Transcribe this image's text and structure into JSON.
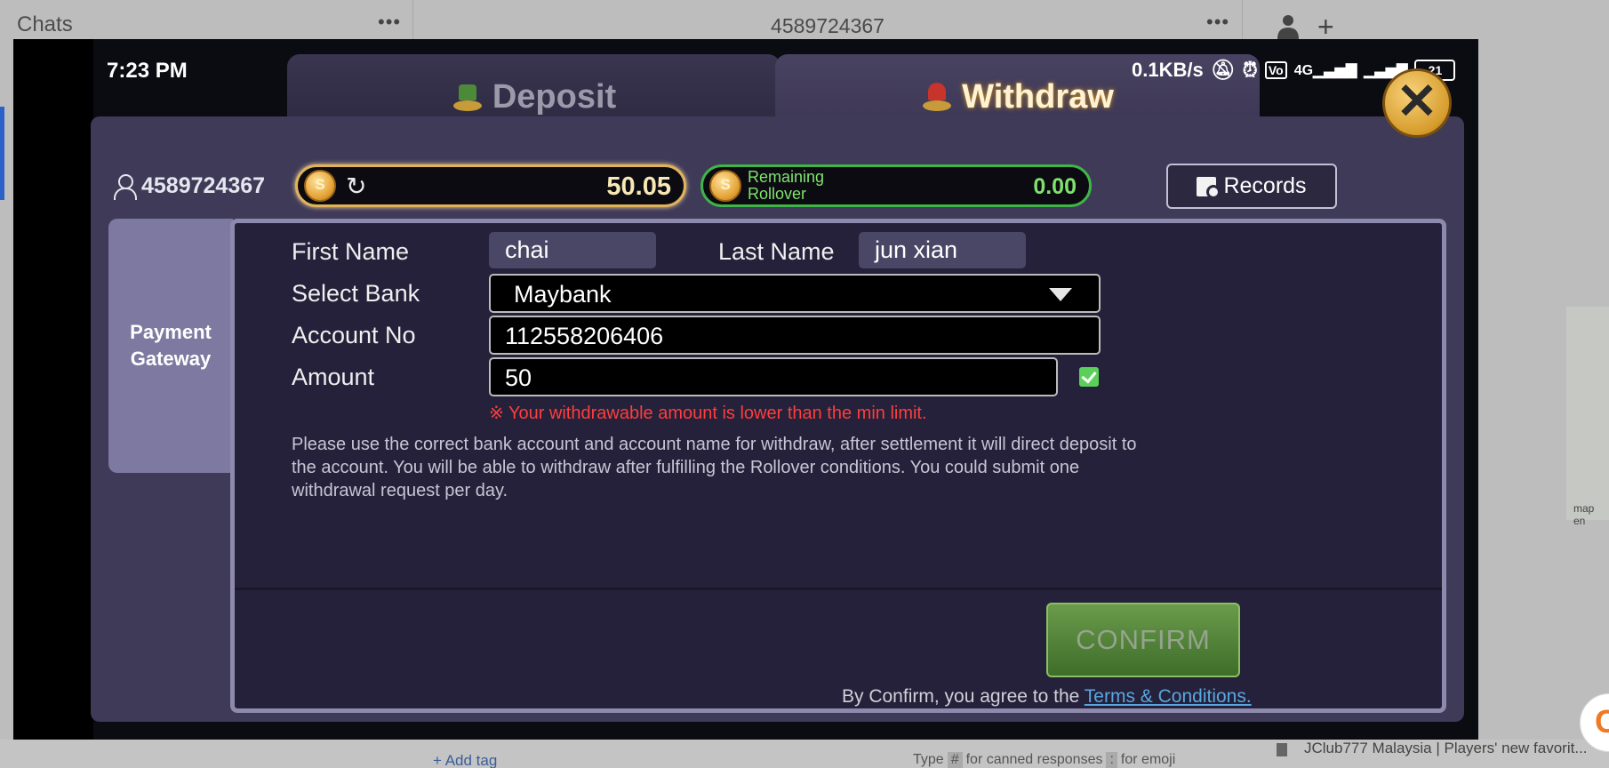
{
  "background_app": {
    "chats_title": "Chats",
    "dots": "•••",
    "conversation_title": "4589724367",
    "add_tag": "+ Add tag",
    "composer_hint_prefix": "Type",
    "composer_hint_hash": "#",
    "composer_hint_middle": "for canned responses",
    "composer_hint_colon": ":",
    "composer_hint_suffix": "for emoji",
    "snippet": "JClub777 Malaysia | Players' new favorit...",
    "map_label": "map en"
  },
  "status_bar": {
    "time": "7:23 PM",
    "speed": "0.1KB/s",
    "battery": "21"
  },
  "tabs": {
    "deposit": "Deposit",
    "withdraw": "Withdraw"
  },
  "account": {
    "user_id": "4589724367",
    "balance": "50.05",
    "rollover_label_line1": "Remaining",
    "rollover_label_line2": "Rollover",
    "rollover_value": "0.00"
  },
  "records_label": "Records",
  "sidebar": {
    "line1": "Payment",
    "line2": "Gateway"
  },
  "form": {
    "first_name_label": "First Name",
    "first_name_value": "chai",
    "last_name_label": "Last Name",
    "last_name_value": "jun xian",
    "bank_label": "Select Bank",
    "bank_value": "Maybank",
    "account_label": "Account No",
    "account_value": "112558206406",
    "amount_label": "Amount",
    "amount_value": "50",
    "error": "※ Your withdrawable amount is lower than the min limit.",
    "info_line1": "Please use the correct bank account and account name for withdraw, after settlement it will direct deposit to",
    "info_line2": "the account. You will be able to withdraw after fulfilling the Rollover conditions. You could submit one",
    "info_line3": "withdrawal request per day."
  },
  "confirm_label": "CONFIRM",
  "terms": {
    "prefix": "By Confirm, you agree to the",
    "link": "Terms & Conditions."
  },
  "colors": {
    "panel": "#3e3a58",
    "form_bg": "#25213a",
    "gold_border": "#e0b35b",
    "rollover_green": "#7ee36b",
    "error_red": "#ff3d3d",
    "link_blue": "#5aa6e0",
    "confirm_green": "#4f8137"
  }
}
